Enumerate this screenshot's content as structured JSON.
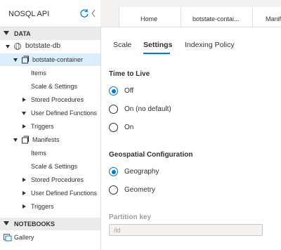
{
  "sidebar": {
    "api_title": "NOSQL API",
    "data_section": "DATA",
    "database": "botstate-db",
    "containers": [
      {
        "name": "botstate-container",
        "items": [
          "Items",
          "Scale & Settings",
          "Stored Procedures",
          "User Defined Functions",
          "Triggers"
        ]
      },
      {
        "name": "Manifests",
        "items": [
          "Items",
          "Scale & Settings",
          "Stored Procedures",
          "User Defined Functions",
          "Triggers"
        ]
      }
    ],
    "notebooks_section": "NOTEBOOKS",
    "gallery": "Gallery"
  },
  "tabs": [
    "Home",
    "botstate-contai...",
    "Manif"
  ],
  "subtabs": [
    "Scale",
    "Settings",
    "Indexing Policy"
  ],
  "active_subtab": "Settings",
  "ttl": {
    "title": "Time to Live",
    "options": [
      "Off",
      "On (no default)",
      "On"
    ],
    "selected": "Off"
  },
  "geo": {
    "title": "Geospatial Configuration",
    "options": [
      "Geography",
      "Geometry"
    ],
    "selected": "Geography"
  },
  "partition": {
    "title": "Partition key",
    "value": "/id"
  },
  "colors": {
    "accent": "#0078d4",
    "selected_bg": "#ddeefb",
    "section_bg": "#edebe9"
  }
}
